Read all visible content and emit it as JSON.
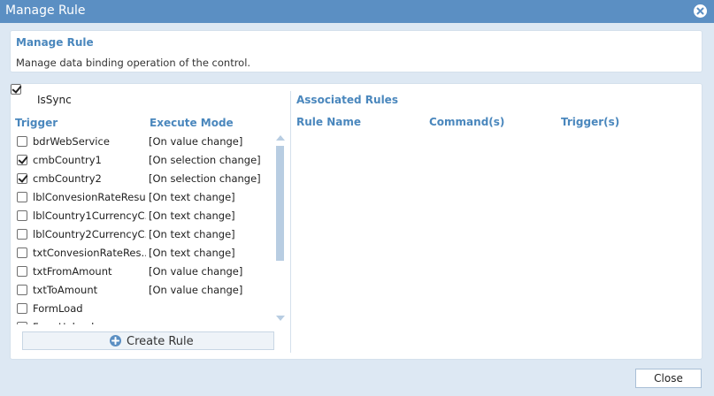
{
  "window": {
    "title": "Manage Rule"
  },
  "header": {
    "title": "Manage Rule",
    "description": "Manage data binding operation of the control."
  },
  "issync": {
    "label": "IsSync",
    "checked": true
  },
  "columns": {
    "trigger": "Trigger",
    "execute_mode": "Execute Mode"
  },
  "triggers": [
    {
      "name": "bdrWebService",
      "mode": "[On value change]",
      "checked": false
    },
    {
      "name": "cmbCountry1",
      "mode": "[On selection change]",
      "checked": true
    },
    {
      "name": "cmbCountry2",
      "mode": "[On selection change]",
      "checked": true
    },
    {
      "name": "lblConvesionRateResult",
      "mode": "[On text change]",
      "checked": false
    },
    {
      "name": "lblCountry1CurrencyC...",
      "mode": "[On text change]",
      "checked": false
    },
    {
      "name": "lblCountry2CurrencyC...",
      "mode": "[On text change]",
      "checked": false
    },
    {
      "name": "txtConvesionRateRes...",
      "mode": "[On text change]",
      "checked": false
    },
    {
      "name": "txtFromAmount",
      "mode": "[On value change]",
      "checked": false
    },
    {
      "name": "txtToAmount",
      "mode": "[On value change]",
      "checked": false
    },
    {
      "name": "FormLoad",
      "mode": "",
      "checked": false
    },
    {
      "name": "FormUnload",
      "mode": "",
      "checked": false
    }
  ],
  "create_rule": {
    "label": "Create Rule"
  },
  "associated": {
    "title": "Associated Rules",
    "col_rule_name": "Rule Name",
    "col_commands": "Command(s)",
    "col_triggers": "Trigger(s)"
  },
  "footer": {
    "close_label": "Close"
  }
}
